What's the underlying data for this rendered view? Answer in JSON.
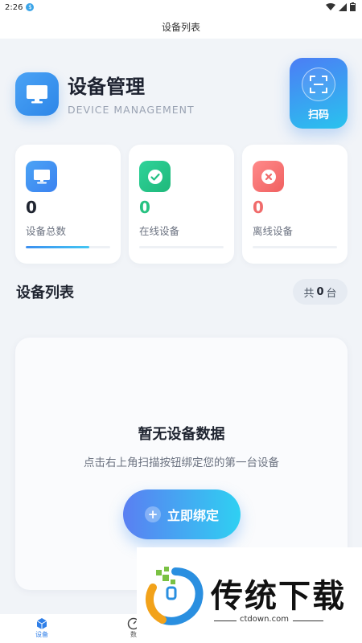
{
  "status_bar": {
    "time": "2:26",
    "notif": "$"
  },
  "title_bar": {
    "title": "设备列表"
  },
  "header": {
    "title": "设备管理",
    "subtitle": "DEVICE MANAGEMENT",
    "scan_label": "扫码"
  },
  "stats": [
    {
      "value": "0",
      "label": "设备总数",
      "color": "#1f2430",
      "icon": "monitor-icon",
      "progress": 0.75
    },
    {
      "value": "0",
      "label": "在线设备",
      "color": "#27c281",
      "icon": "check-circle-icon",
      "progress": 0
    },
    {
      "value": "0",
      "label": "离线设备",
      "color": "#f06b6b",
      "icon": "x-circle-icon",
      "progress": 0
    }
  ],
  "section": {
    "title": "设备列表",
    "count_prefix": "共",
    "count": "0",
    "count_suffix": "台"
  },
  "empty": {
    "title": "暂无设备数据",
    "description": "点击右上角扫描按钮绑定您的第一台设备",
    "button_label": "立即绑定"
  },
  "tabbar": {
    "items": [
      {
        "label": "设备"
      },
      {
        "label": "数"
      }
    ]
  },
  "watermark": {
    "name": "传统下载",
    "url": "ctdown.com"
  },
  "colors": {
    "accent": "#2f7fe8",
    "online": "#27c281",
    "offline": "#f06b6b"
  }
}
